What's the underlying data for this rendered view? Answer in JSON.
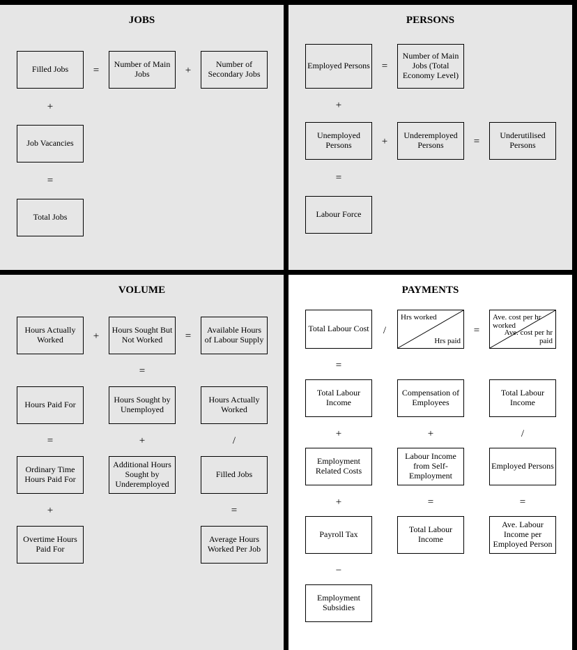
{
  "jobs": {
    "title": "JOBS",
    "filled": "Filled Jobs",
    "nMain": "Number of Main Jobs",
    "nSec": "Number of Secondary Jobs",
    "vac": "Job Vacancies",
    "total": "Total Jobs",
    "eq1": "=",
    "plus1": "+",
    "plus2": "+",
    "eq2": "="
  },
  "persons": {
    "title": "PERSONS",
    "emp": "Employed Persons",
    "mainTotal": "Number of Main Jobs (Total Economy Level)",
    "unemp": "Unemployed Persons",
    "under": "Underemployed Persons",
    "util": "Underutilised Persons",
    "lf": "Labour Force",
    "eq1": "=",
    "plus1": "+",
    "plus2": "+",
    "eq2": "=",
    "eq3": "="
  },
  "volume": {
    "title": "VOLUME",
    "haw": "Hours Actually Worked",
    "hsnw": "Hours Sought But Not Worked",
    "avail": "Available Hours of Labour Supply",
    "hpf": "Hours Paid For",
    "hsu": "Hours Sought by Unemployed",
    "haw2": "Hours Actually Worked",
    "othpf": "Ordinary Time Hours Paid For",
    "ahsu": "Additional Hours Sought by Underemployed",
    "fj": "Filled Jobs",
    "ohpf": "Overtime Hours Paid For",
    "avg": "Average Hours Worked Per Job",
    "r1plus": "+",
    "r1eq": "=",
    "r2eqA": "=",
    "r2eqB": "=",
    "r3plus": "+",
    "r3div": "/",
    "r4plus": "+",
    "r4eq": "="
  },
  "payments": {
    "title": "PAYMENTS",
    "tlc": "Total Labour Cost",
    "hrsW": "Hrs worked",
    "hrsP": "Hrs paid",
    "acW": "Ave. cost per hr worked",
    "acP": "Ave. cost per hr paid",
    "tli": "Total Labour Income",
    "coe": "Compensation of Employees",
    "tli2": "Total Labour Income",
    "erc": "Employment Related Costs",
    "lise": "Labour Income from Self-Employment",
    "ep": "Employed Persons",
    "pt": "Payroll Tax",
    "tli3": "Total Labour Income",
    "avgInc": "Ave. Labour Income per Employed Person",
    "es": "Employment Subsidies",
    "r1div": "/",
    "r1eq": "=",
    "r2eq": "=",
    "r3plusA": "+",
    "r3plusB": "+",
    "r3div": "/",
    "r4plus": "+",
    "r4eqA": "=",
    "r4eqB": "=",
    "r5minus": "−"
  }
}
